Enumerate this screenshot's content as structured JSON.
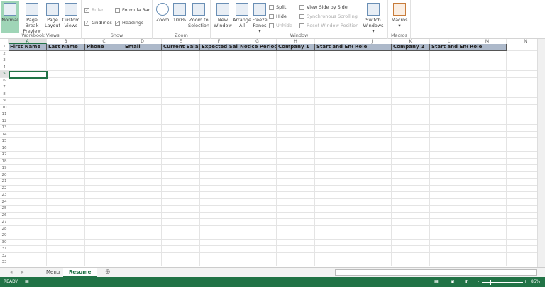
{
  "ribbon": {
    "workbook_views": {
      "label": "Workbook Views",
      "buttons": [
        "Normal",
        "Page Break Preview",
        "Page Layout",
        "Custom Views"
      ]
    },
    "show": {
      "label": "Show",
      "items": [
        {
          "label": "Ruler",
          "checked": true,
          "disabled": true
        },
        {
          "label": "Formula Bar",
          "checked": false
        },
        {
          "label": "Gridlines",
          "checked": true
        },
        {
          "label": "Headings",
          "checked": true
        }
      ]
    },
    "zoom": {
      "label": "Zoom",
      "buttons": [
        "Zoom",
        "100%",
        "Zoom to Selection"
      ]
    },
    "window": {
      "label": "Window",
      "buttons": [
        "New Window",
        "Arrange All",
        "Freeze Panes"
      ],
      "small": [
        "Split",
        "Hide",
        "Unhide"
      ],
      "side": [
        "View Side by Side",
        "Synchronous Scrolling",
        "Reset Window Position"
      ],
      "switch": "Switch Windows"
    },
    "macros": {
      "label": "Macros",
      "button": "Macros"
    }
  },
  "grid": {
    "columns": [
      "A",
      "B",
      "C",
      "D",
      "E",
      "F",
      "G",
      "H",
      "I",
      "J",
      "K",
      "L",
      "M",
      "N"
    ],
    "header_row": [
      "First Name",
      "Last Name",
      "Phone",
      "Email",
      "Current Salary",
      "Expected Salary",
      "Notice Period",
      "Company 1",
      "Start and End d",
      "Role",
      "Company 2",
      "Start and End d",
      "Role"
    ],
    "row_count": 33,
    "selected_cell": "A5",
    "header_fill": "#adb9ca"
  },
  "sheets": {
    "tabs": [
      "Menu",
      "Resume"
    ],
    "active": "Resume"
  },
  "status": {
    "mode": "READY",
    "zoom": "85%",
    "zoom_level_percent": 85,
    "accent": "#217346"
  }
}
